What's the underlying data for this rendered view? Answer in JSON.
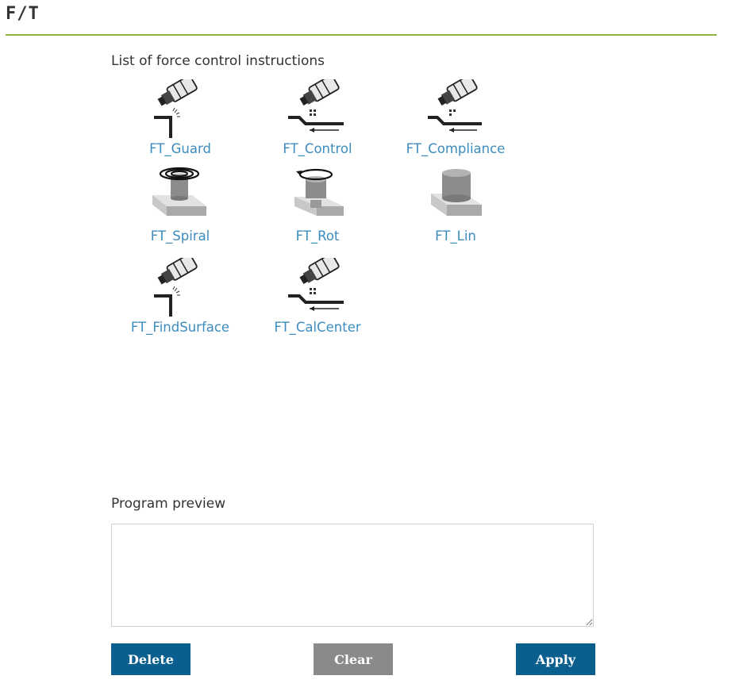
{
  "header": {
    "title": "F/T"
  },
  "instructions": {
    "label": "List of force control instructions",
    "items": [
      {
        "name": "FT_Guard",
        "icon": "robot-guard-icon"
      },
      {
        "name": "FT_Control",
        "icon": "robot-control-icon"
      },
      {
        "name": "FT_Compliance",
        "icon": "robot-compliance-icon"
      },
      {
        "name": "FT_Spiral",
        "icon": "spiral-insert-icon"
      },
      {
        "name": "FT_Rot",
        "icon": "rotate-insert-icon"
      },
      {
        "name": "FT_Lin",
        "icon": "linear-insert-icon"
      },
      {
        "name": "FT_FindSurface",
        "icon": "robot-find-surface-icon"
      },
      {
        "name": "FT_CalCenter",
        "icon": "robot-cal-center-icon"
      }
    ]
  },
  "preview": {
    "label": "Program preview",
    "value": ""
  },
  "buttons": {
    "delete": "Delete",
    "clear": "Clear",
    "apply": "Apply"
  },
  "colors": {
    "accent_rule": "#8ab63f",
    "link": "#3c8cbf",
    "primary_button": "#0a5f8f",
    "secondary_button": "#8a8a8a"
  }
}
